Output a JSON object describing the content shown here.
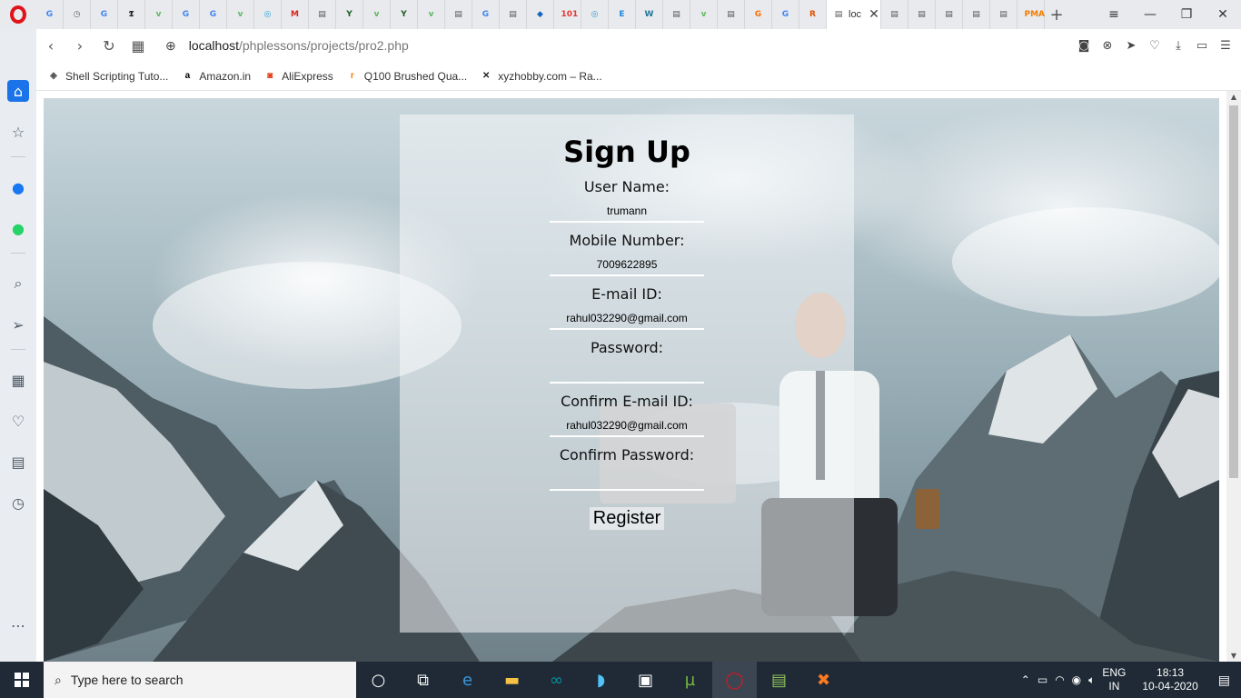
{
  "browser": {
    "tabs": [
      {
        "icon": "google-icon",
        "glyph": "G",
        "color": "#4285f4"
      },
      {
        "icon": "history-icon",
        "glyph": "◷",
        "color": "#666"
      },
      {
        "icon": "google-icon",
        "glyph": "G",
        "color": "#4285f4"
      },
      {
        "icon": "nyt-icon",
        "glyph": "𝕿",
        "color": "#111"
      },
      {
        "icon": "vts-icon",
        "glyph": "v",
        "color": "#5cb85c"
      },
      {
        "icon": "google-icon",
        "glyph": "G",
        "color": "#4285f4"
      },
      {
        "icon": "google-icon",
        "glyph": "G",
        "color": "#4285f4"
      },
      {
        "icon": "vts-icon",
        "glyph": "v",
        "color": "#5cb85c"
      },
      {
        "icon": "globe-icon",
        "glyph": "◎",
        "color": "#2a9fd6"
      },
      {
        "icon": "microchip-icon",
        "glyph": "M",
        "color": "#d9261c"
      },
      {
        "icon": "document-icon",
        "glyph": "▤",
        "color": "#555"
      },
      {
        "icon": "y-icon",
        "glyph": "Y",
        "color": "#1b5e20"
      },
      {
        "icon": "vts-icon",
        "glyph": "v",
        "color": "#5cb85c"
      },
      {
        "icon": "y-icon",
        "glyph": "Y",
        "color": "#1b5e20"
      },
      {
        "icon": "vts-icon",
        "glyph": "v",
        "color": "#5cb85c"
      },
      {
        "icon": "document-icon",
        "glyph": "▤",
        "color": "#555"
      },
      {
        "icon": "google-icon",
        "glyph": "G",
        "color": "#4285f4"
      },
      {
        "icon": "document-icon",
        "glyph": "▤",
        "color": "#555"
      },
      {
        "icon": "arrow-icon",
        "glyph": "◆",
        "color": "#1565c0"
      },
      {
        "icon": "101-icon",
        "glyph": "101",
        "color": "#e53935"
      },
      {
        "icon": "globe-icon",
        "glyph": "◎",
        "color": "#2a9fd6"
      },
      {
        "icon": "e-icon",
        "glyph": "E",
        "color": "#1e88e5"
      },
      {
        "icon": "wordpress-icon",
        "glyph": "W",
        "color": "#21759b"
      },
      {
        "icon": "document-icon",
        "glyph": "▤",
        "color": "#555"
      },
      {
        "icon": "vts-icon",
        "glyph": "v",
        "color": "#5cb85c"
      },
      {
        "icon": "document-icon",
        "glyph": "▤",
        "color": "#555"
      },
      {
        "icon": "g-orange-icon",
        "glyph": "G",
        "color": "#ff6d00"
      },
      {
        "icon": "google-icon",
        "glyph": "G",
        "color": "#4285f4"
      },
      {
        "icon": "r-icon",
        "glyph": "R",
        "color": "#e65100"
      }
    ],
    "active_tab_title": "loc",
    "trailing_tabs": [
      {
        "icon": "document-icon",
        "glyph": "▤",
        "color": "#555"
      },
      {
        "icon": "document-icon",
        "glyph": "▤",
        "color": "#555"
      },
      {
        "icon": "document-icon",
        "glyph": "▤",
        "color": "#555"
      },
      {
        "icon": "document-icon",
        "glyph": "▤",
        "color": "#555"
      },
      {
        "icon": "document-icon",
        "glyph": "▤",
        "color": "#555"
      },
      {
        "icon": "pma-icon",
        "glyph": "PMA",
        "color": "#f57c00"
      }
    ],
    "url_host": "localhost",
    "url_path": "/phplessons/projects/pro2.php",
    "bookmarks": [
      {
        "label": "Shell Scripting Tuto...",
        "icon": "shell-icon",
        "glyph": "◈",
        "color": "#555"
      },
      {
        "label": "Amazon.in",
        "icon": "amazon-icon",
        "glyph": "a",
        "color": "#000"
      },
      {
        "label": "AliExpress",
        "icon": "aliexpress-icon",
        "glyph": "◙",
        "color": "#e62e04"
      },
      {
        "label": "Q100 Brushed Qua...",
        "icon": "r-circle-icon",
        "glyph": "r",
        "color": "#f57c00"
      },
      {
        "label": "xyzhobby.com – Ra...",
        "icon": "x-icon",
        "glyph": "✕",
        "color": "#222"
      }
    ]
  },
  "form": {
    "title": "Sign Up",
    "fields": [
      {
        "label": "User Name:",
        "value": "trumann",
        "type": "text"
      },
      {
        "label": "Mobile Number:",
        "value": "7009622895",
        "type": "text"
      },
      {
        "label": "E-mail ID:",
        "value": "rahul032290@gmail.com",
        "type": "text"
      },
      {
        "label": "Password:",
        "value": "",
        "type": "password"
      },
      {
        "label": "Confirm E-mail ID:",
        "value": "rahul032290@gmail.com",
        "type": "text"
      },
      {
        "label": "Confirm Password:",
        "value": "",
        "type": "password"
      }
    ],
    "submit_label": "Register"
  },
  "taskbar": {
    "search_placeholder": "Type here to search",
    "lang_top": "ENG",
    "lang_bottom": "IN",
    "time": "18:13",
    "date": "10-04-2020"
  }
}
